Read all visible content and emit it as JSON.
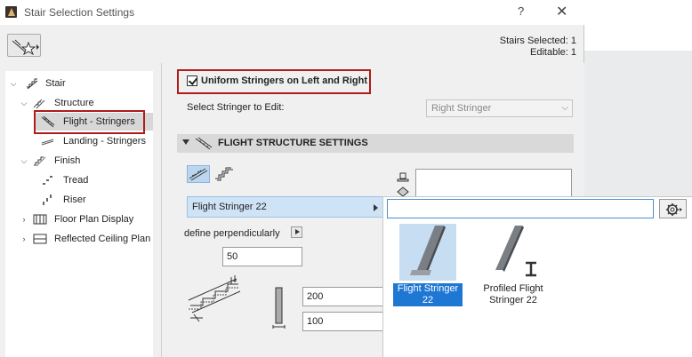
{
  "window": {
    "title": "Stair Selection Settings",
    "help": "?",
    "close": "✕"
  },
  "selection_info": {
    "selected": "Stairs Selected: 1",
    "editable": "Editable: 1"
  },
  "tree": {
    "stair": "Stair",
    "structure": "Structure",
    "flight_stringers": "Flight - Stringers",
    "landing_stringers": "Landing - Stringers",
    "finish": "Finish",
    "tread": "Tread",
    "riser": "Riser",
    "floor_plan_display": "Floor Plan Display",
    "reflected_ceiling_plan": "Reflected Ceiling Plan"
  },
  "main": {
    "uniform_checkbox_label": "Uniform Stringers on Left and Right",
    "uniform_checked": true,
    "select_stringer_label": "Select Stringer to Edit:",
    "select_stringer_value": "Right Stringer",
    "section_title": "FLIGHT STRUCTURE SETTINGS",
    "stringer_name": "Flight Stringer 22",
    "define_perpendicularly": "define perpendicularly",
    "value_50": "50",
    "value_200": "200",
    "value_100": "100"
  },
  "popup": {
    "search_placeholder": "",
    "items": [
      {
        "label_line1": "Flight Stringer",
        "label_line2": "22",
        "selected": true
      },
      {
        "label_line1": "Profiled Flight",
        "label_line2": "Stringer 22",
        "selected": false
      }
    ]
  },
  "colors": {
    "highlight_red": "#b11b1b",
    "selection_blue": "#1f77d4",
    "light_blue": "#cfe3f6"
  }
}
